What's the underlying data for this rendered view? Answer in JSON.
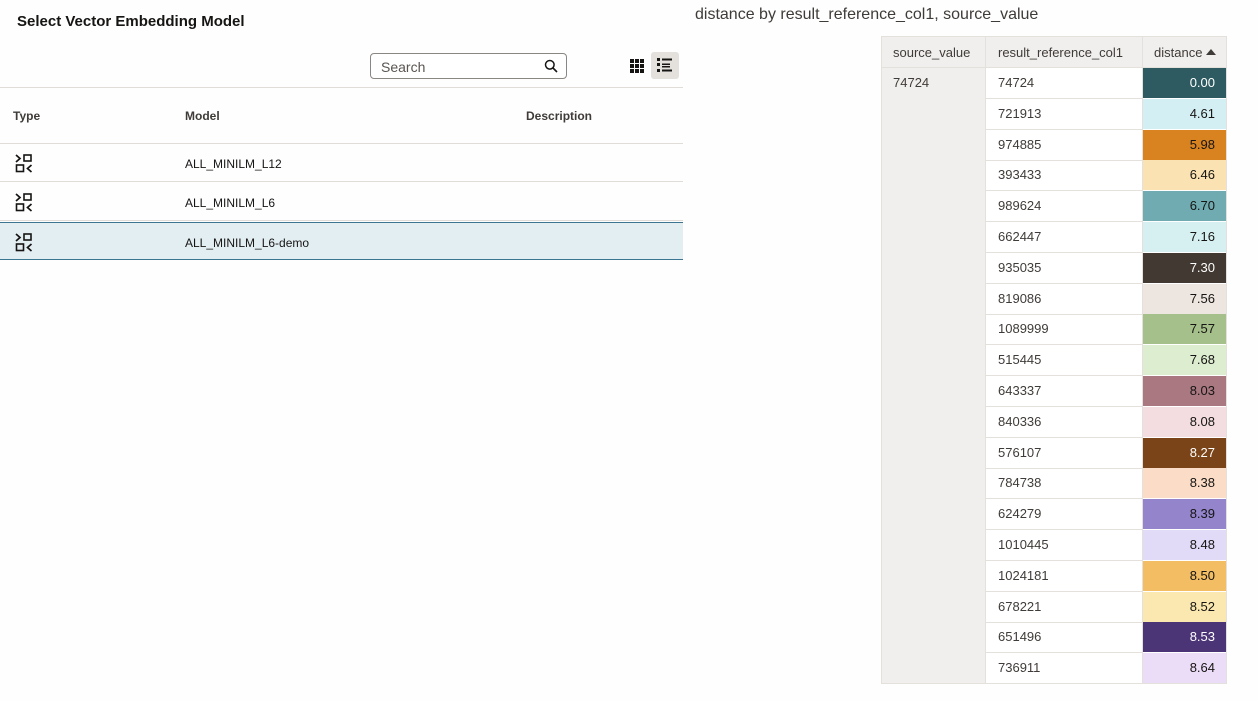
{
  "panel": {
    "title": "Select Vector Embedding Model",
    "search": {
      "placeholder": "Search",
      "value": ""
    },
    "view_toggle": {
      "grid_icon": "grid-view-icon",
      "list_icon": "list-view-icon",
      "active": "list"
    },
    "columns": {
      "type": "Type",
      "model": "Model",
      "description": "Description"
    },
    "rows": [
      {
        "icon": "vector-model-icon",
        "model": "ALL_MINILM_L12",
        "description": "",
        "selected": false
      },
      {
        "icon": "vector-model-icon",
        "model": "ALL_MINILM_L6",
        "description": "",
        "selected": false
      },
      {
        "icon": "vector-model-icon",
        "model": "ALL_MINILM_L6-demo",
        "description": "",
        "selected": true
      }
    ]
  },
  "pivot": {
    "title": "distance by result_reference_col1, source_value",
    "columns": {
      "source": "source_value",
      "reference": "result_reference_col1",
      "distance": "distance"
    },
    "sort": "distance ascending",
    "source_value": "74724",
    "rows": [
      {
        "ref": "74724",
        "distance": "0.00",
        "bg": "#2e5b62",
        "fg": "#ffffff"
      },
      {
        "ref": "721913",
        "distance": "4.61",
        "bg": "#d3eff4",
        "fg": "#161513"
      },
      {
        "ref": "974885",
        "distance": "5.98",
        "bg": "#d98320",
        "fg": "#161513"
      },
      {
        "ref": "393433",
        "distance": "6.46",
        "bg": "#fae2b2",
        "fg": "#161513"
      },
      {
        "ref": "989624",
        "distance": "6.70",
        "bg": "#6fabb0",
        "fg": "#161513"
      },
      {
        "ref": "662447",
        "distance": "7.16",
        "bg": "#d6f0f1",
        "fg": "#161513"
      },
      {
        "ref": "935035",
        "distance": "7.30",
        "bg": "#423a32",
        "fg": "#ffffff"
      },
      {
        "ref": "819086",
        "distance": "7.56",
        "bg": "#ede5df",
        "fg": "#161513"
      },
      {
        "ref": "1089999",
        "distance": "7.57",
        "bg": "#a5c08b",
        "fg": "#161513"
      },
      {
        "ref": "515445",
        "distance": "7.68",
        "bg": "#ddedd0",
        "fg": "#161513"
      },
      {
        "ref": "643337",
        "distance": "8.03",
        "bg": "#a97880",
        "fg": "#161513"
      },
      {
        "ref": "840336",
        "distance": "8.08",
        "bg": "#f3dde0",
        "fg": "#161513"
      },
      {
        "ref": "576107",
        "distance": "8.27",
        "bg": "#7a4418",
        "fg": "#ffffff"
      },
      {
        "ref": "784738",
        "distance": "8.38",
        "bg": "#fbdcc6",
        "fg": "#161513"
      },
      {
        "ref": "624279",
        "distance": "8.39",
        "bg": "#9384cc",
        "fg": "#161513"
      },
      {
        "ref": "1010445",
        "distance": "8.48",
        "bg": "#e1dbf7",
        "fg": "#161513"
      },
      {
        "ref": "1024181",
        "distance": "8.50",
        "bg": "#f3bd63",
        "fg": "#161513"
      },
      {
        "ref": "678221",
        "distance": "8.52",
        "bg": "#fbe8b0",
        "fg": "#161513"
      },
      {
        "ref": "651496",
        "distance": "8.53",
        "bg": "#4b3577",
        "fg": "#ffffff"
      },
      {
        "ref": "736911",
        "distance": "8.64",
        "bg": "#ebdcf7",
        "fg": "#161513"
      }
    ]
  }
}
